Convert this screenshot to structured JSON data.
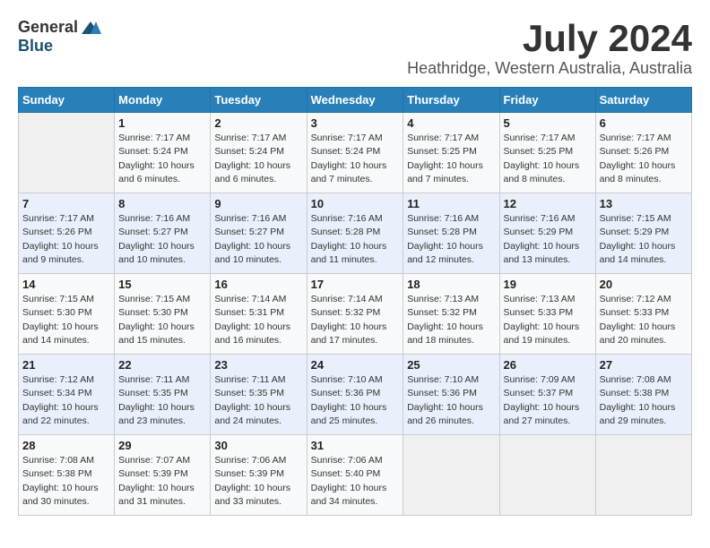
{
  "header": {
    "logo_general": "General",
    "logo_blue": "Blue",
    "month": "July 2024",
    "location": "Heathridge, Western Australia, Australia"
  },
  "columns": [
    "Sunday",
    "Monday",
    "Tuesday",
    "Wednesday",
    "Thursday",
    "Friday",
    "Saturday"
  ],
  "weeks": [
    [
      {
        "day": "",
        "sunrise": "",
        "sunset": "",
        "daylight": ""
      },
      {
        "day": "1",
        "sunrise": "Sunrise: 7:17 AM",
        "sunset": "Sunset: 5:24 PM",
        "daylight": "Daylight: 10 hours and 6 minutes."
      },
      {
        "day": "2",
        "sunrise": "Sunrise: 7:17 AM",
        "sunset": "Sunset: 5:24 PM",
        "daylight": "Daylight: 10 hours and 6 minutes."
      },
      {
        "day": "3",
        "sunrise": "Sunrise: 7:17 AM",
        "sunset": "Sunset: 5:24 PM",
        "daylight": "Daylight: 10 hours and 7 minutes."
      },
      {
        "day": "4",
        "sunrise": "Sunrise: 7:17 AM",
        "sunset": "Sunset: 5:25 PM",
        "daylight": "Daylight: 10 hours and 7 minutes."
      },
      {
        "day": "5",
        "sunrise": "Sunrise: 7:17 AM",
        "sunset": "Sunset: 5:25 PM",
        "daylight": "Daylight: 10 hours and 8 minutes."
      },
      {
        "day": "6",
        "sunrise": "Sunrise: 7:17 AM",
        "sunset": "Sunset: 5:26 PM",
        "daylight": "Daylight: 10 hours and 8 minutes."
      }
    ],
    [
      {
        "day": "7",
        "sunrise": "Sunrise: 7:17 AM",
        "sunset": "Sunset: 5:26 PM",
        "daylight": "Daylight: 10 hours and 9 minutes."
      },
      {
        "day": "8",
        "sunrise": "Sunrise: 7:16 AM",
        "sunset": "Sunset: 5:27 PM",
        "daylight": "Daylight: 10 hours and 10 minutes."
      },
      {
        "day": "9",
        "sunrise": "Sunrise: 7:16 AM",
        "sunset": "Sunset: 5:27 PM",
        "daylight": "Daylight: 10 hours and 10 minutes."
      },
      {
        "day": "10",
        "sunrise": "Sunrise: 7:16 AM",
        "sunset": "Sunset: 5:28 PM",
        "daylight": "Daylight: 10 hours and 11 minutes."
      },
      {
        "day": "11",
        "sunrise": "Sunrise: 7:16 AM",
        "sunset": "Sunset: 5:28 PM",
        "daylight": "Daylight: 10 hours and 12 minutes."
      },
      {
        "day": "12",
        "sunrise": "Sunrise: 7:16 AM",
        "sunset": "Sunset: 5:29 PM",
        "daylight": "Daylight: 10 hours and 13 minutes."
      },
      {
        "day": "13",
        "sunrise": "Sunrise: 7:15 AM",
        "sunset": "Sunset: 5:29 PM",
        "daylight": "Daylight: 10 hours and 14 minutes."
      }
    ],
    [
      {
        "day": "14",
        "sunrise": "Sunrise: 7:15 AM",
        "sunset": "Sunset: 5:30 PM",
        "daylight": "Daylight: 10 hours and 14 minutes."
      },
      {
        "day": "15",
        "sunrise": "Sunrise: 7:15 AM",
        "sunset": "Sunset: 5:30 PM",
        "daylight": "Daylight: 10 hours and 15 minutes."
      },
      {
        "day": "16",
        "sunrise": "Sunrise: 7:14 AM",
        "sunset": "Sunset: 5:31 PM",
        "daylight": "Daylight: 10 hours and 16 minutes."
      },
      {
        "day": "17",
        "sunrise": "Sunrise: 7:14 AM",
        "sunset": "Sunset: 5:32 PM",
        "daylight": "Daylight: 10 hours and 17 minutes."
      },
      {
        "day": "18",
        "sunrise": "Sunrise: 7:13 AM",
        "sunset": "Sunset: 5:32 PM",
        "daylight": "Daylight: 10 hours and 18 minutes."
      },
      {
        "day": "19",
        "sunrise": "Sunrise: 7:13 AM",
        "sunset": "Sunset: 5:33 PM",
        "daylight": "Daylight: 10 hours and 19 minutes."
      },
      {
        "day": "20",
        "sunrise": "Sunrise: 7:12 AM",
        "sunset": "Sunset: 5:33 PM",
        "daylight": "Daylight: 10 hours and 20 minutes."
      }
    ],
    [
      {
        "day": "21",
        "sunrise": "Sunrise: 7:12 AM",
        "sunset": "Sunset: 5:34 PM",
        "daylight": "Daylight: 10 hours and 22 minutes."
      },
      {
        "day": "22",
        "sunrise": "Sunrise: 7:11 AM",
        "sunset": "Sunset: 5:35 PM",
        "daylight": "Daylight: 10 hours and 23 minutes."
      },
      {
        "day": "23",
        "sunrise": "Sunrise: 7:11 AM",
        "sunset": "Sunset: 5:35 PM",
        "daylight": "Daylight: 10 hours and 24 minutes."
      },
      {
        "day": "24",
        "sunrise": "Sunrise: 7:10 AM",
        "sunset": "Sunset: 5:36 PM",
        "daylight": "Daylight: 10 hours and 25 minutes."
      },
      {
        "day": "25",
        "sunrise": "Sunrise: 7:10 AM",
        "sunset": "Sunset: 5:36 PM",
        "daylight": "Daylight: 10 hours and 26 minutes."
      },
      {
        "day": "26",
        "sunrise": "Sunrise: 7:09 AM",
        "sunset": "Sunset: 5:37 PM",
        "daylight": "Daylight: 10 hours and 27 minutes."
      },
      {
        "day": "27",
        "sunrise": "Sunrise: 7:08 AM",
        "sunset": "Sunset: 5:38 PM",
        "daylight": "Daylight: 10 hours and 29 minutes."
      }
    ],
    [
      {
        "day": "28",
        "sunrise": "Sunrise: 7:08 AM",
        "sunset": "Sunset: 5:38 PM",
        "daylight": "Daylight: 10 hours and 30 minutes."
      },
      {
        "day": "29",
        "sunrise": "Sunrise: 7:07 AM",
        "sunset": "Sunset: 5:39 PM",
        "daylight": "Daylight: 10 hours and 31 minutes."
      },
      {
        "day": "30",
        "sunrise": "Sunrise: 7:06 AM",
        "sunset": "Sunset: 5:39 PM",
        "daylight": "Daylight: 10 hours and 33 minutes."
      },
      {
        "day": "31",
        "sunrise": "Sunrise: 7:06 AM",
        "sunset": "Sunset: 5:40 PM",
        "daylight": "Daylight: 10 hours and 34 minutes."
      },
      {
        "day": "",
        "sunrise": "",
        "sunset": "",
        "daylight": ""
      },
      {
        "day": "",
        "sunrise": "",
        "sunset": "",
        "daylight": ""
      },
      {
        "day": "",
        "sunrise": "",
        "sunset": "",
        "daylight": ""
      }
    ]
  ]
}
